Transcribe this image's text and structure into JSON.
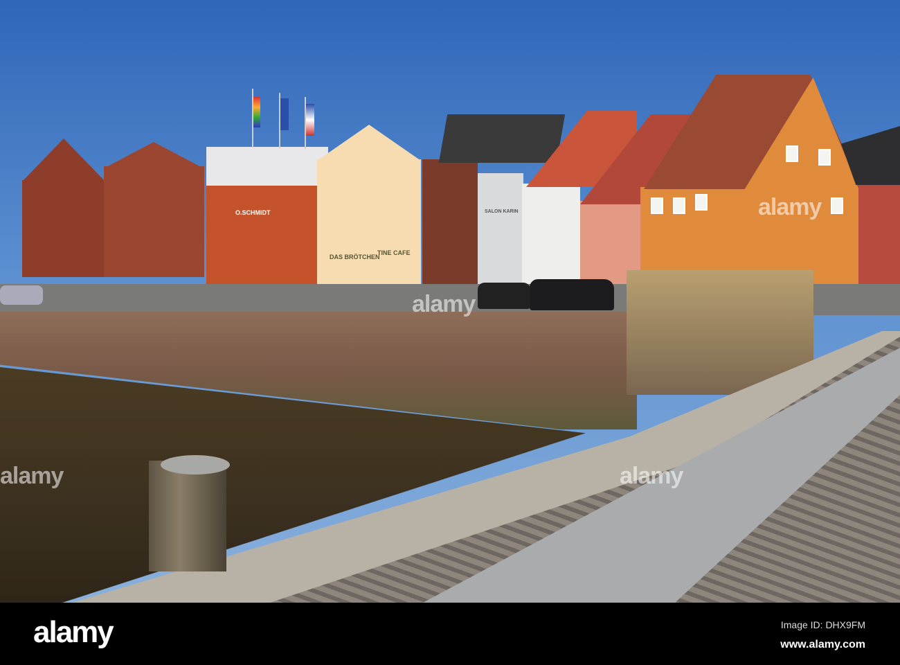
{
  "photo": {
    "signs": {
      "shop1": "O.SCHMIDT",
      "shop2": "DAS BRÖTCHEN",
      "shop3": "TINE CAFE",
      "shop4": "SALON KARIN"
    },
    "colors": {
      "sky": "#2f66b8",
      "water": "#4a3b22",
      "orange_house": "#e08a3c",
      "brick": "#8e3d2a"
    }
  },
  "watermark": {
    "text": "alamy"
  },
  "footer": {
    "logo": "alamy",
    "image_id": "Image ID: DHX9FM",
    "url": "www.alamy.com"
  }
}
